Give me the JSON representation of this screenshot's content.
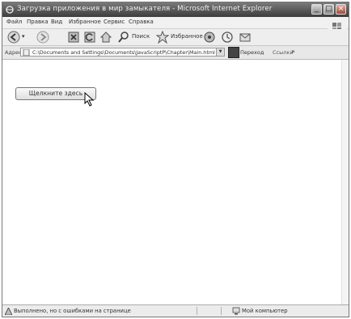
{
  "window": {
    "title": "Загрузка приложения в мир замыкателя - Microsoft Internet Explorer"
  },
  "menu": {
    "items": [
      "Файл",
      "Правка",
      "Вид",
      "Избранное",
      "Сервис",
      "Справка"
    ]
  },
  "toolbar": {
    "search_label": "Поиск",
    "favorites_label": "Избранное"
  },
  "address": {
    "label": "Адрес:",
    "url": "C:\\Documents and Settings\\Documents\\JavaScriptP\\Chapter\\Main.html",
    "go_label": "Переход",
    "links_label": "Ссылки"
  },
  "page": {
    "button_label": "Щелкните здесь"
  },
  "status": {
    "text": "Выполнено, но с ошибками на странице",
    "zone": "Мой компьютер"
  },
  "colors": {
    "titlebar": "#4a4a4a",
    "chrome": "#eeeeee"
  }
}
